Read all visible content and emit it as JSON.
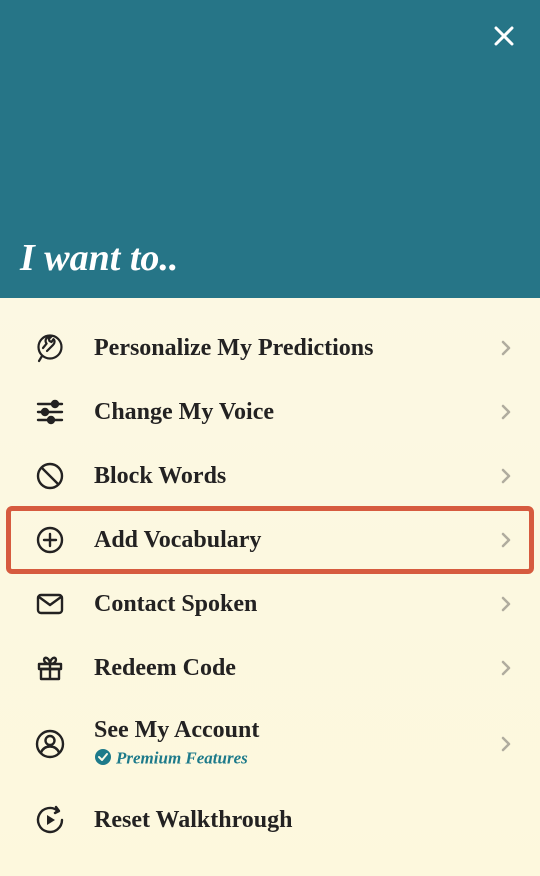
{
  "header": {
    "title": "I want to.."
  },
  "menu": {
    "items": [
      {
        "label": "Personalize My Predictions"
      },
      {
        "label": "Change My Voice"
      },
      {
        "label": "Block Words"
      },
      {
        "label": "Add Vocabulary",
        "highlighted": true
      },
      {
        "label": "Contact Spoken"
      },
      {
        "label": "Redeem Code"
      },
      {
        "label": "See My Account",
        "subtitle": "Premium Features"
      },
      {
        "label": "Reset Walkthrough"
      }
    ]
  }
}
